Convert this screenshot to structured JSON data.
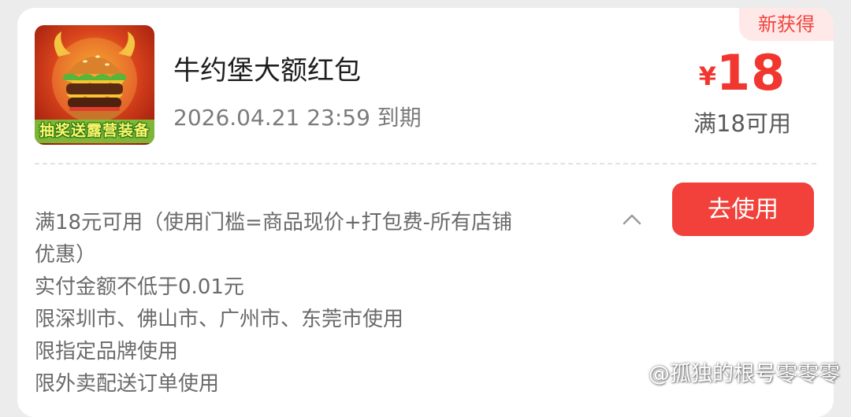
{
  "coupon": {
    "badge": "新获得",
    "title": "牛约堡大额红包",
    "expiry": "2026.04.21 23:59 到期",
    "image_banner": "抽奖送露营装备",
    "currency": "¥",
    "amount": "18",
    "threshold": "满18可用",
    "use_button": "去使用",
    "rules": [
      "满18元可用（使用门槛=商品现价+打包费-所有店铺",
      "优惠）",
      "实付金额不低于0.01元",
      "限深圳市、佛山市、广州市、东莞市使用",
      "限指定品牌使用",
      "限外卖配送订单使用"
    ]
  },
  "watermark": {
    "text": "@孤独的根号零零零"
  },
  "colors": {
    "accent": "#f2403a",
    "price": "#f0362f",
    "badge_bg": "#ffe8e8",
    "card_bg": "#ffffff",
    "page_bg": "#ececec"
  },
  "icons": {
    "expand": "chevron-up-icon",
    "watermark_logo": "weibo-logo-icon"
  }
}
